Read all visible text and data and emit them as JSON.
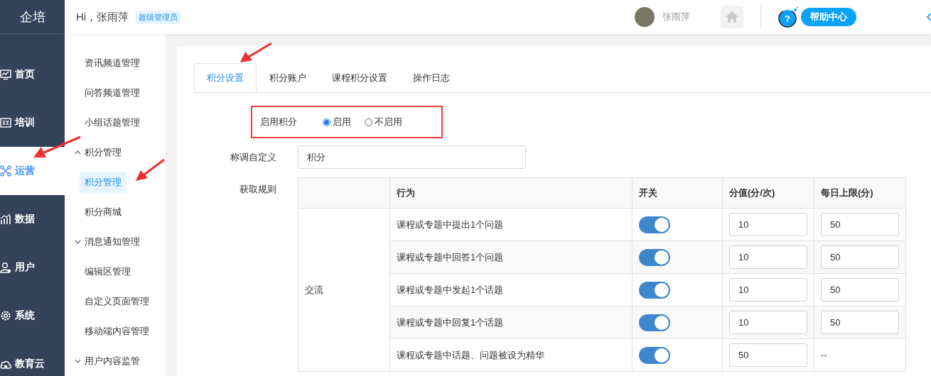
{
  "sidebar": {
    "logo": "企培",
    "items": [
      {
        "label": "首页",
        "selected": false
      },
      {
        "label": "培训",
        "selected": false
      },
      {
        "label": "运营",
        "selected": true
      },
      {
        "label": "数据",
        "selected": false
      },
      {
        "label": "用户",
        "selected": false
      },
      {
        "label": "系统",
        "selected": false
      },
      {
        "label": "教育云",
        "selected": false
      }
    ]
  },
  "header": {
    "greeting": "Hi，张雨萍",
    "role_badge": "超级管理员",
    "user_name": "张雨萍",
    "help_button": "帮助中心",
    "help_icon": "?"
  },
  "submenu": [
    {
      "kind": "item",
      "label": "资讯频道管理",
      "selected": false
    },
    {
      "kind": "item",
      "label": "问答频道管理",
      "selected": false
    },
    {
      "kind": "item",
      "label": "小组话题管理",
      "selected": false
    },
    {
      "kind": "group",
      "label": "积分管理",
      "expanded": true,
      "children": [
        {
          "kind": "item",
          "label": "积分管理",
          "selected": true
        },
        {
          "kind": "item",
          "label": "积分商城",
          "selected": false
        }
      ]
    },
    {
      "kind": "group",
      "label": "消息通知管理",
      "expanded": false
    },
    {
      "kind": "item",
      "label": "编辑区管理",
      "selected": false
    },
    {
      "kind": "item",
      "label": "自定义页面管理",
      "selected": false
    },
    {
      "kind": "item",
      "label": "移动端内容管理",
      "selected": false
    },
    {
      "kind": "group",
      "label": "用户内容监管",
      "expanded": false
    }
  ],
  "tabs": [
    {
      "label": "积分设置",
      "selected": true
    },
    {
      "label": "积分账户",
      "selected": false
    },
    {
      "label": "课程积分设置",
      "selected": false
    },
    {
      "label": "操作日志",
      "selected": false
    }
  ],
  "form": {
    "enable_label": "启用积分",
    "enable_options": [
      {
        "label": "启用",
        "selected": true
      },
      {
        "label": "不启用",
        "selected": false
      }
    ],
    "name_label": "称调自定义",
    "name_value": "积分",
    "rules_label": "获取规则"
  },
  "rules_table": {
    "columns": [
      "行为",
      "开关",
      "分值(分/次)",
      "每日上限(分)"
    ],
    "groups": [
      {
        "category": "交流",
        "rows": [
          {
            "kind": "limited",
            "action": "课程或专题中提出1个问题",
            "on": true,
            "points": "10",
            "daily_limit": "50"
          },
          {
            "kind": "limited",
            "action": "课程或专题中回答1个问题",
            "on": true,
            "points": "10",
            "daily_limit": "50"
          },
          {
            "kind": "limited",
            "action": "课程或专题中发起1个话题",
            "on": true,
            "points": "10",
            "daily_limit": "50"
          },
          {
            "kind": "limited",
            "action": "课程或专题中回复1个话题",
            "on": true,
            "points": "10",
            "daily_limit": "50"
          },
          {
            "kind": "unlimited",
            "action": "课程或专题中话题、问题被设为精华",
            "on": true,
            "points": "50",
            "daily_limit": "--"
          }
        ]
      }
    ]
  }
}
